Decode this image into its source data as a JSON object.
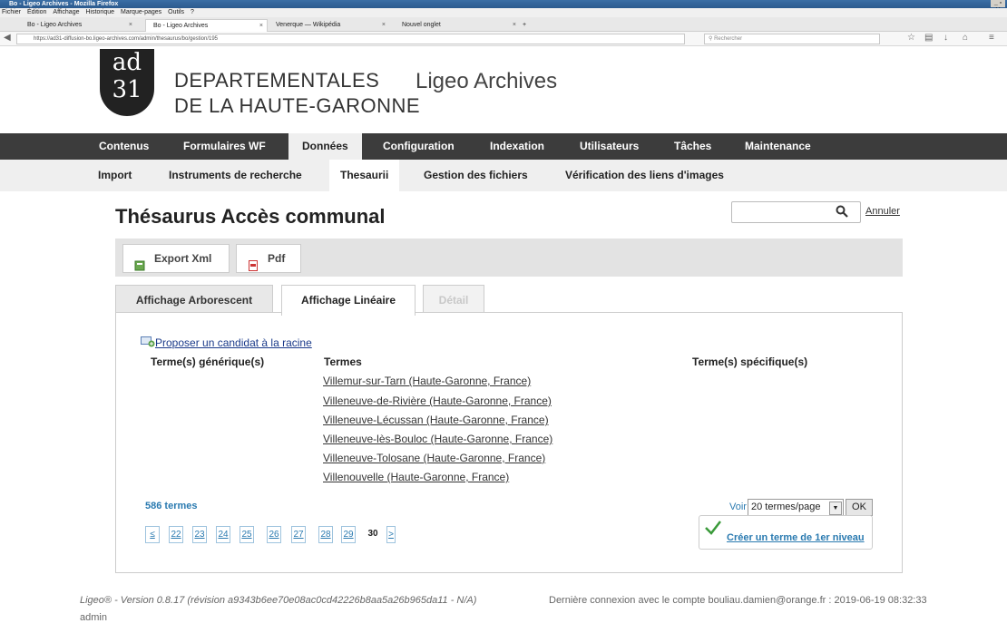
{
  "window": {
    "title": "Bo - Ligeo Archives - Mozilla Firefox",
    "controls": "_ ▫ ✕"
  },
  "menu": [
    "Fichier",
    "Édition",
    "Affichage",
    "Historique",
    "Marque-pages",
    "Outils",
    "?"
  ],
  "tabs": [
    {
      "label": "Bo - Ligeo Archives"
    },
    {
      "label": "Bo - Ligeo Archives"
    },
    {
      "label": "Venerque — Wikipédia"
    },
    {
      "label": "Nouvel onglet"
    }
  ],
  "tab_close": "×",
  "new_tab": "+",
  "url": "https://ad31-diffusion-bo.ligeo-archives.com/admin/thesaurus/bo/gestion/195",
  "browser_search_placeholder": "Rechercher",
  "header": {
    "logo_text": "ad 31",
    "dept_line1": "DEPARTEMENTALES",
    "dept_line2": "DE LA HAUTE-GARONNE",
    "app_name": "Ligeo Archives"
  },
  "main_nav": [
    "Contenus",
    "Formulaires WF",
    "Données",
    "Configuration",
    "Indexation",
    "Utilisateurs",
    "Tâches",
    "Maintenance"
  ],
  "sub_nav": [
    "Import",
    "Instruments de recherche",
    "Thesaurii",
    "Gestion des fichiers",
    "Vérification des liens d'images"
  ],
  "page": {
    "title": "Thésaurus Accès communal",
    "search_value": "",
    "cancel_label": "Annuler"
  },
  "toolbar": {
    "export_label": "Export Xml",
    "pdf_label": "Pdf"
  },
  "view_tabs": [
    "Affichage Arborescent",
    "Affichage Linéaire",
    "Détail"
  ],
  "content": {
    "propose_label": "Proposer un candidat à la racine",
    "col_generic": "Terme(s) générique(s)",
    "col_terms": "Termes",
    "col_specific": "Terme(s) spécifique(s)",
    "terms": [
      "Villemur-sur-Tarn (Haute-Garonne, France)",
      "Villeneuve-de-Rivière (Haute-Garonne, France)",
      "Villeneuve-Lécussan (Haute-Garonne, France)",
      "Villeneuve-lès-Bouloc (Haute-Garonne, France)",
      "Villeneuve-Tolosane (Haute-Garonne, France)",
      "Villenouvelle (Haute-Garonne, France)"
    ],
    "count_label": "586 termes",
    "voir_label": "Voir",
    "per_page": "20 termes/page",
    "ok_label": "OK",
    "create_label": "Créer un terme de 1er niveau",
    "pagination": [
      "≤",
      "22",
      "23",
      "24",
      "25",
      "26",
      "27",
      "28",
      "29",
      "30",
      ">"
    ],
    "current_page": "30"
  },
  "footer": {
    "version": "Ligeo® - Version 0.8.17 (révision a9343b6ee70e08ac0cd42226b8aa5a26b965da11 - N/A)",
    "last_login": "Dernière connexion avec le compte bouliau.damien@orange.fr : 2019-06-19 08:32:33",
    "user": "admin"
  }
}
